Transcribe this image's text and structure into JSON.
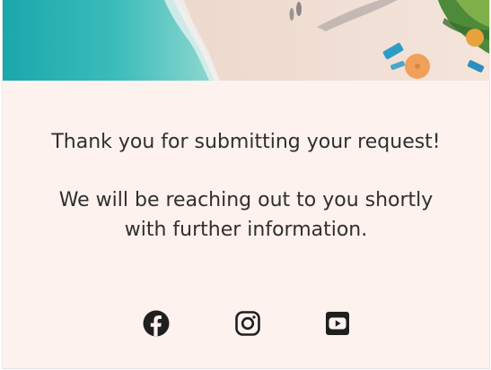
{
  "hero": {
    "image": "beach-aerial-image"
  },
  "message": {
    "line1": "Thank you for submitting your request!",
    "line2": "We will be reaching out to you shortly with further information."
  },
  "social": {
    "items": [
      {
        "icon": "facebook-icon",
        "label": "Facebook"
      },
      {
        "icon": "instagram-icon",
        "label": "Instagram"
      },
      {
        "icon": "youtube-icon",
        "label": "YouTube"
      }
    ]
  },
  "colors": {
    "background": "#fdf2ee",
    "text": "#2f2f2f",
    "icon": "#1f1f1f",
    "sea": "#2fb4b6",
    "sand": "#f0ddd2"
  }
}
